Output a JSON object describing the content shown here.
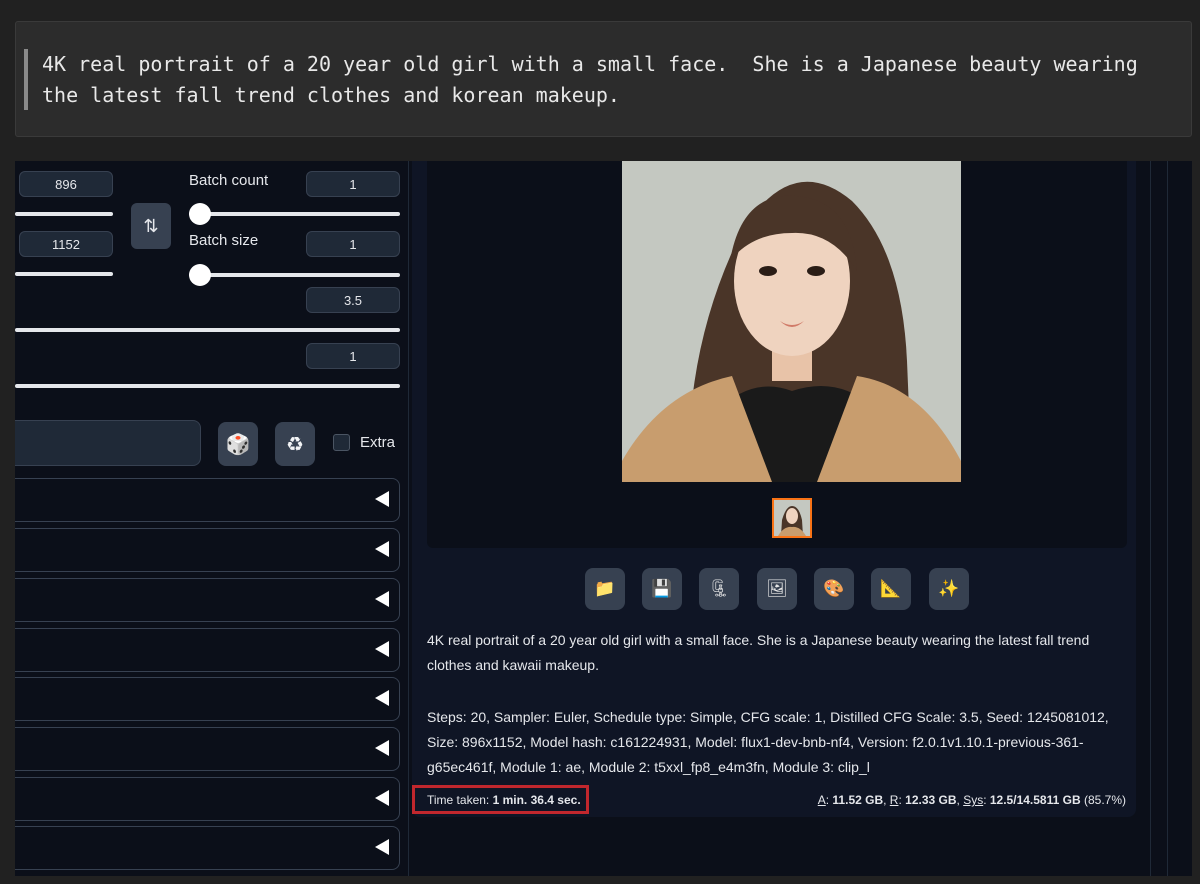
{
  "prompt": {
    "text": "4K real portrait of a 20 year old girl with a small face.  She is a Japanese beauty wearing the latest fall trend clothes and korean makeup."
  },
  "params": {
    "width_value": "896",
    "height_value": "1152",
    "batch_count_label": "Batch count",
    "batch_count_value": "1",
    "batch_size_label": "Batch size",
    "batch_size_value": "1",
    "cfg_value": "3.5",
    "steps_value": "1",
    "extra_label": "Extra"
  },
  "output": {
    "caption": "4K real portrait of a 20 year old girl with a small face. She is a Japanese beauty wearing the latest fall trend clothes and kawaii makeup.",
    "generation_info": "Steps: 20, Sampler: Euler, Schedule type: Simple, CFG scale: 1, Distilled CFG Scale: 3.5, Seed: 1245081012, Size: 896x1152, Model hash: c161224931, Model: flux1-dev-bnb-nf4, Version: f2.0.1v1.10.1-previous-361-g65ec461f, Module 1: ae, Module 2: t5xxl_fp8_e4m3fn, Module 3: clip_l",
    "time_label": "Time taken:",
    "time_value": "1 min. 36.4 sec.",
    "vram_a_label": "A",
    "vram_a_value": "11.52 GB",
    "vram_r_label": "R",
    "vram_r_value": "12.33 GB",
    "vram_sys_label": "Sys",
    "vram_sys_value": "12.5/14.5811 GB",
    "vram_pct": "(85.7%)"
  },
  "icons": {
    "swap": "⇅",
    "dice": "🎲",
    "recycle": "♻",
    "folder": "📁",
    "save": "💾",
    "zip": "🗜",
    "image": "🖼",
    "palette": "🎨",
    "triangle": "📐",
    "sparkles": "✨"
  },
  "colors": {
    "background": "#0b0f19",
    "accent_highlight": "#c1272d",
    "thumbnail_border": "#f97316"
  }
}
